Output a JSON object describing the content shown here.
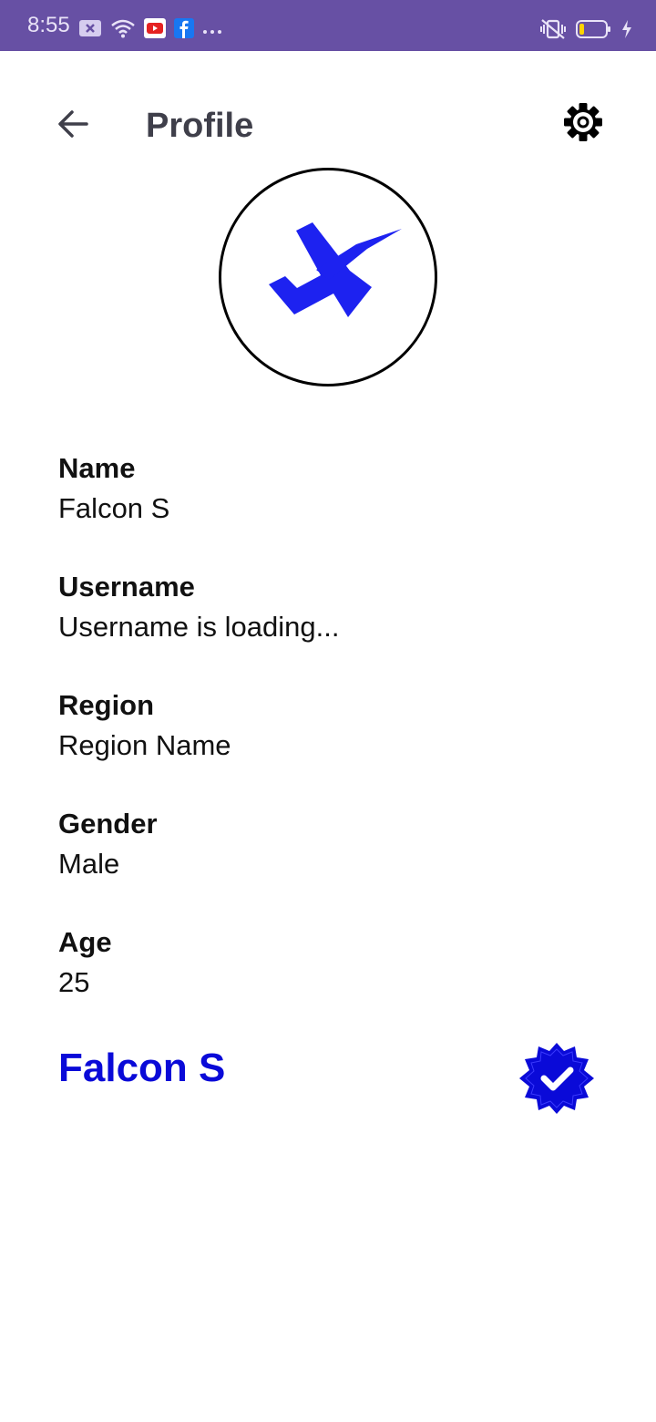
{
  "status_bar": {
    "time": "8:55",
    "icons": [
      "message-icon",
      "wifi-icon",
      "youtube-icon",
      "facebook-icon",
      "more-icon",
      "vibrate-off-icon",
      "battery-icon",
      "charging-icon"
    ],
    "background": "#6750a4"
  },
  "header": {
    "title": "Profile",
    "back_icon": "arrow-left-icon",
    "settings_icon": "gear-icon"
  },
  "profile": {
    "avatar_icon": "logo-icon",
    "fields": [
      {
        "label": "Name",
        "value": "Falcon S"
      },
      {
        "label": "Username",
        "value": "Username is loading..."
      },
      {
        "label": "Region",
        "value": "Region Name"
      },
      {
        "label": "Gender",
        "value": "Male"
      },
      {
        "label": "Age",
        "value": "25"
      }
    ],
    "display_name": "Falcon S",
    "verified_icon": "verified-badge-icon",
    "accent_color": "#0a0ad8"
  }
}
